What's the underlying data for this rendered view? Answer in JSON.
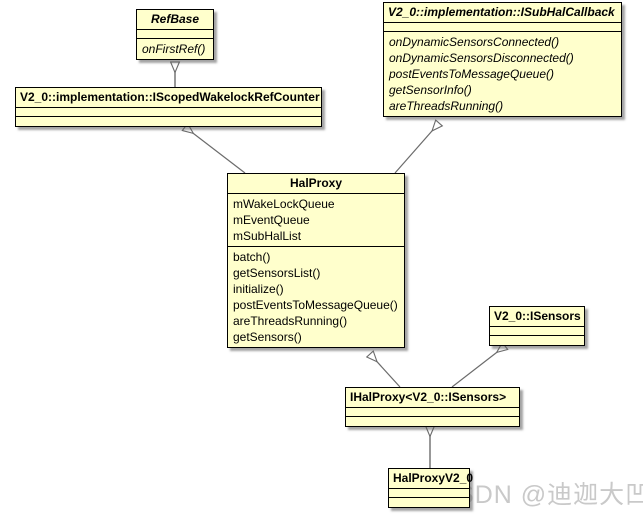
{
  "diagram": {
    "type": "uml-class-diagram",
    "background_color": "#ffffff",
    "class_fill_color": "#ffffcc",
    "class_border_color": "#000000",
    "edge_color": "#6b6b6b",
    "watermark": "CSDN @迪迦大凹凸曼"
  },
  "classes": {
    "refbase": {
      "name": "RefBase",
      "attributes": [],
      "operations": [
        "onFirstRef()"
      ]
    },
    "iscoped_wakelock_ref_counter": {
      "name": "V2_0::implementation::IScopedWakelockRefCounter",
      "attributes": [],
      "operations": []
    },
    "isubhal_callback": {
      "name": "V2_0::implementation::ISubHalCallback",
      "attributes": [],
      "operations": [
        "onDynamicSensorsConnected()",
        "onDynamicSensorsDisconnected()",
        "postEventsToMessageQueue()",
        "getSensorInfo()",
        "areThreadsRunning()"
      ]
    },
    "halproxy": {
      "name": "HalProxy",
      "attributes": [
        "mWakeLockQueue",
        "mEventQueue",
        "mSubHalList"
      ],
      "operations": [
        "batch()",
        "getSensorsList()",
        "initialize()",
        "postEventsToMessageQueue()",
        "areThreadsRunning()",
        "getSensors()"
      ]
    },
    "isensors": {
      "name": "V2_0::ISensors",
      "attributes": [],
      "operations": []
    },
    "ihalproxy": {
      "name": "IHalProxy<V2_0::ISensors>",
      "attributes": [],
      "operations": []
    },
    "halproxyv2_0": {
      "name": "HalProxyV2_0",
      "attributes": [],
      "operations": []
    }
  },
  "relationships": [
    {
      "from": "V2_0::implementation::IScopedWakelockRefCounter",
      "to": "RefBase",
      "kind": "generalization"
    },
    {
      "from": "HalProxy",
      "to": "V2_0::implementation::IScopedWakelockRefCounter",
      "kind": "generalization"
    },
    {
      "from": "HalProxy",
      "to": "V2_0::implementation::ISubHalCallback",
      "kind": "generalization"
    },
    {
      "from": "IHalProxy<V2_0::ISensors>",
      "to": "HalProxy",
      "kind": "generalization"
    },
    {
      "from": "IHalProxy<V2_0::ISensors>",
      "to": "V2_0::ISensors",
      "kind": "generalization"
    },
    {
      "from": "HalProxyV2_0",
      "to": "IHalProxy<V2_0::ISensors>",
      "kind": "generalization"
    }
  ]
}
